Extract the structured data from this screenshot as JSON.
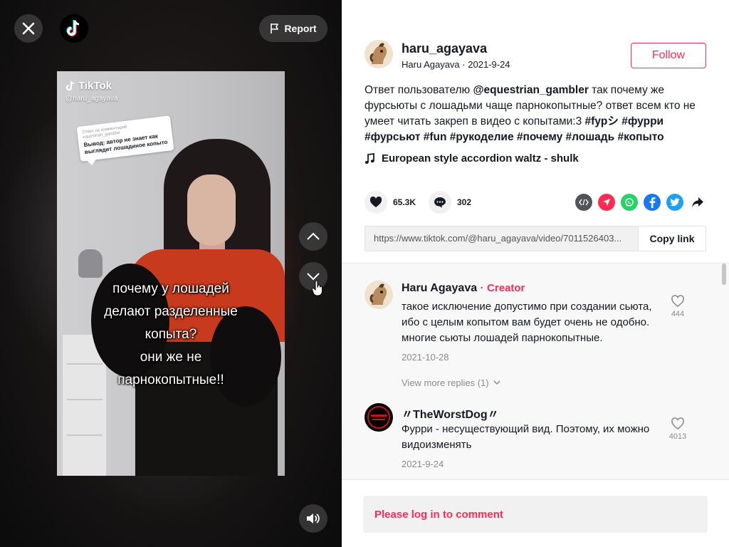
{
  "video": {
    "report_label": "Report",
    "watermark_brand": "TikTok",
    "watermark_handle": "@haru_agayava",
    "sticker_meta_1": "Ответ на комментарий",
    "sticker_meta_2": "equestrian_gambler",
    "sticker_body": "Вывод: автор не знает как выглядит лошадиное копыто",
    "caption_lines": [
      "почему у лошадей",
      "делают разделенные",
      "копыта?",
      "они же не",
      "парнокопытные!!"
    ]
  },
  "post": {
    "handle": "haru_agayava",
    "display_name": "Haru Agayava",
    "separator": "·",
    "date": "2021-9-24",
    "follow_label": "Follow",
    "desc_prefix": "Ответ пользователю",
    "desc_mention": "@equestrian_gambler",
    "desc_body": "так почему же фурсьюты с лошадьми чаще парнокопытные? ответ всем кто не умеет читать закреп в видео с копытами:3",
    "desc_tags": "#fypシ #фурри #фурсьют #fun #рукоделие #почему #лошадь #копыто",
    "music": "European style accordion waltz - shulk",
    "likes": "65.3K",
    "comments_count": "302",
    "link": "https://www.tiktok.com/@haru_agayava/video/7011526403...",
    "copy_label": "Copy link"
  },
  "comments": [
    {
      "name": "Haru Agayava",
      "separator": "·",
      "badge": "Creator",
      "text": "такое исключение допустимо при создании сьюта, ибо с целым копытом вам будет очень не одобно. многие сьюты лошадей парнокопытные.",
      "date": "2021-10-28",
      "likes": "444",
      "more_replies": "View more replies (1)"
    },
    {
      "name": "〃TheWorstDog〃",
      "text": "Фурри - несуществующий вид. Поэтому, их можно видоизменять",
      "date": "2021-9-24",
      "likes": "4013"
    }
  ],
  "login_prompt": "Please log in to comment",
  "colors": {
    "brand": "#fe2c55",
    "text": "#161823",
    "muted": "#8a8b91"
  }
}
